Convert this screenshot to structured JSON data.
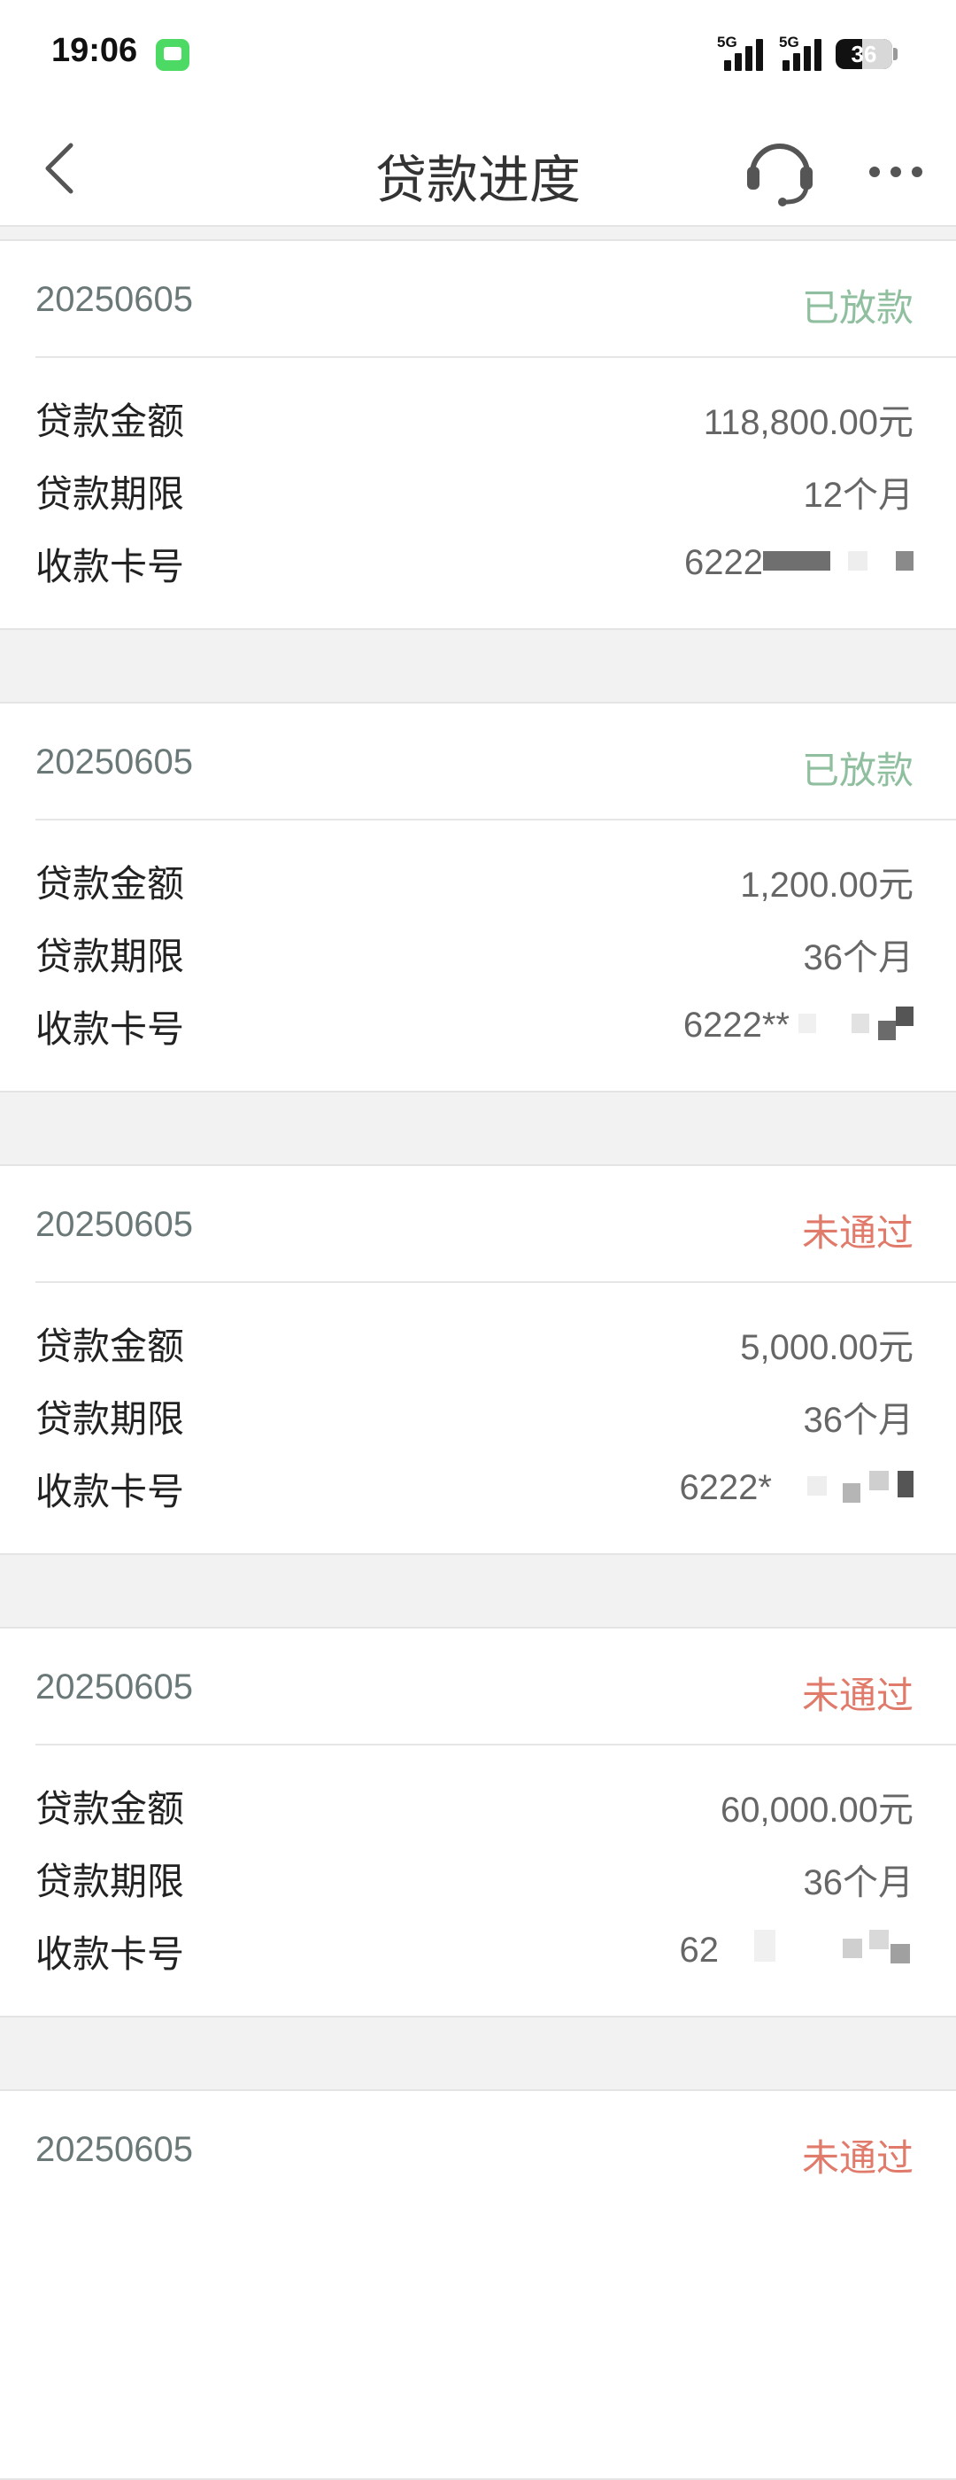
{
  "status_bar": {
    "time": "19:06",
    "network_1": "5G",
    "network_2": "5G",
    "battery_level": "36"
  },
  "nav": {
    "title": "贷款进度"
  },
  "labels": {
    "amount": "贷款金额",
    "term": "贷款期限",
    "card": "收款卡号"
  },
  "colors": {
    "disbursed": "#8fbf9f",
    "rejected": "#e07a6a"
  },
  "loans": [
    {
      "date": "20250605",
      "status": "已放款",
      "amount": "118,800.00元",
      "term": "12个月",
      "card": "6222"
    },
    {
      "date": "20250605",
      "status": "已放款",
      "amount": "1,200.00元",
      "term": "36个月",
      "card": "6222**"
    },
    {
      "date": "20250605",
      "status": "未通过",
      "amount": "5,000.00元",
      "term": "36个月",
      "card": "6222*"
    },
    {
      "date": "20250605",
      "status": "未通过",
      "amount": "60,000.00元",
      "term": "36个月",
      "card": "62"
    },
    {
      "date": "20250605",
      "status": "未通过"
    }
  ]
}
